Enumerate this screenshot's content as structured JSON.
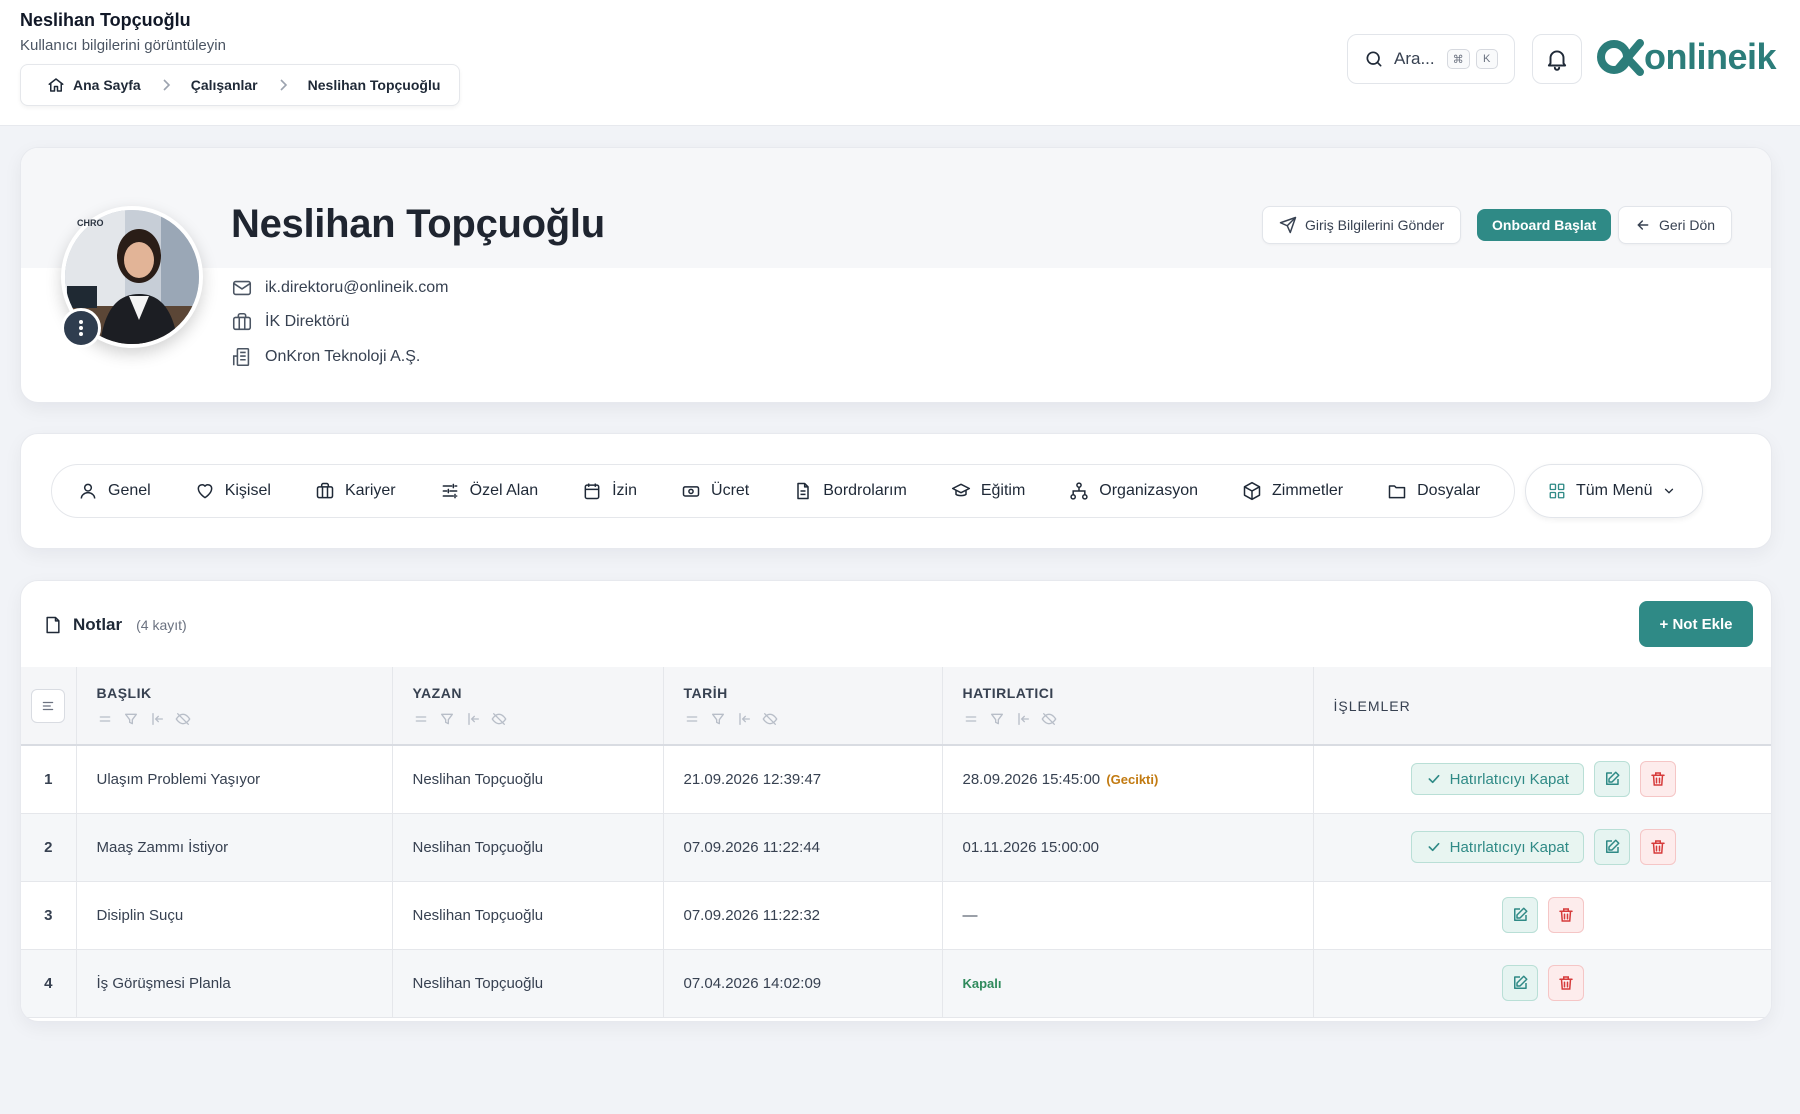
{
  "header": {
    "title": "Neslihan Topçuoğlu",
    "subtitle": "Kullanıcı bilgilerini görüntüleyin",
    "breadcrumb": [
      "Ana Sayfa",
      "Çalışanlar",
      "Neslihan Topçuoğlu"
    ],
    "search": {
      "placeholder": "Ara...",
      "shortcut_keys": [
        "⌘",
        "K"
      ]
    },
    "logo_text": "onlineik",
    "brand_color": "#2c7d7a"
  },
  "profile": {
    "name": "Neslihan Topçuoğlu",
    "email": "ik.direktoru@onlineik.com",
    "position": "İK Direktörü",
    "company": "OnKron Teknoloji A.Ş.",
    "avatar_badge": "CHRO",
    "buttons": {
      "send_login": "Giriş Bilgilerini Gönder",
      "start_onboard": "Onboard Başlat",
      "back": "Geri Dön"
    }
  },
  "tabs": [
    {
      "label": "Genel",
      "icon": "user-icon"
    },
    {
      "label": "Kişisel",
      "icon": "heart-icon"
    },
    {
      "label": "Kariyer",
      "icon": "briefcase-icon"
    },
    {
      "label": "Özel Alan",
      "icon": "sliders-icon"
    },
    {
      "label": "İzin",
      "icon": "calendar-icon"
    },
    {
      "label": "Ücret",
      "icon": "banknote-icon"
    },
    {
      "label": "Bordrolarım",
      "icon": "document-icon"
    },
    {
      "label": "Eğitim",
      "icon": "graduation-cap-icon"
    },
    {
      "label": "Organizasyon",
      "icon": "org-chart-icon"
    },
    {
      "label": "Zimmetler",
      "icon": "package-icon"
    },
    {
      "label": "Dosyalar",
      "icon": "folder-icon"
    }
  ],
  "all_menu_label": "Tüm Menü",
  "notes": {
    "title": "Notlar",
    "count_label": "(4 kayıt)",
    "add_button": "+ Not Ekle",
    "columns": {
      "title": "BAŞLIK",
      "author": "YAZAN",
      "date": "TARİH",
      "reminder": "HATIRLATICI",
      "actions": "İŞLEMLER"
    },
    "close_reminder_label": "Hatırlatıcıyı Kapat",
    "rows": [
      {
        "no": "1",
        "title": "Ulaşım Problemi Yaşıyor",
        "author": "Neslihan Topçuoğlu",
        "date": "21.09.2026 12:39:47",
        "reminder": "28.09.2026 15:45:00",
        "reminder_status": "(Gecikti)",
        "has_reminder": true
      },
      {
        "no": "2",
        "title": "Maaş Zammı İstiyor",
        "author": "Neslihan Topçuoğlu",
        "date": "07.09.2026 11:22:44",
        "reminder": "01.11.2026 15:00:00",
        "reminder_status": "",
        "has_reminder": true
      },
      {
        "no": "3",
        "title": "Disiplin Suçu",
        "author": "Neslihan Topçuoğlu",
        "date": "07.09.2026 11:22:32",
        "reminder": "—",
        "reminder_status": "",
        "has_reminder": false
      },
      {
        "no": "4",
        "title": "İş Görüşmesi Planla",
        "author": "Neslihan Topçuoğlu",
        "date": "07.04.2026 14:02:09",
        "reminder": "",
        "reminder_status": "Kapalı",
        "has_reminder": false
      }
    ]
  }
}
